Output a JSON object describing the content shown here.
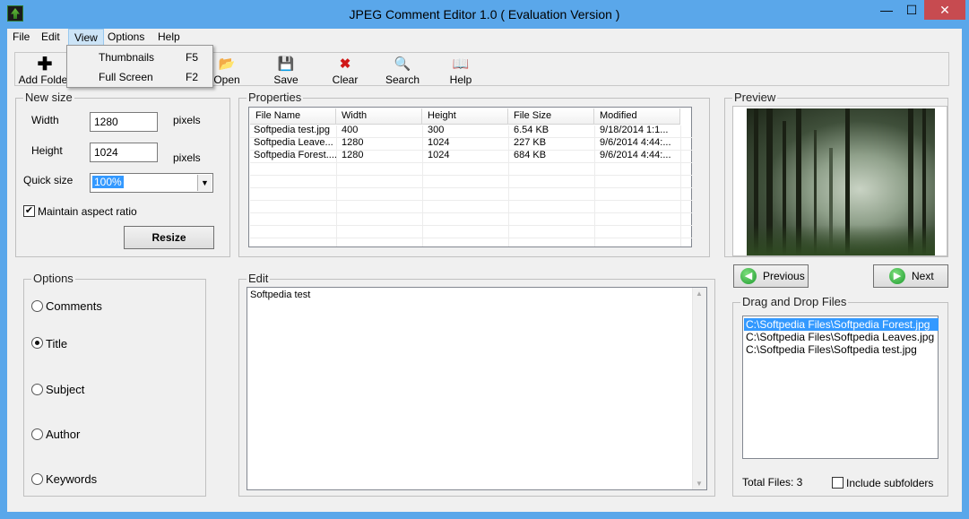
{
  "window": {
    "title": "JPEG Comment Editor 1.0 ( Evaluation Version )",
    "min_glyph": "—",
    "max_glyph": "☐",
    "close_glyph": "✕"
  },
  "menubar": {
    "file": "File",
    "edit": "Edit",
    "view": "View",
    "options": "Options",
    "help": "Help"
  },
  "view_menu": {
    "items": [
      {
        "label": "Thumbnails",
        "shortcut": "F5"
      },
      {
        "label": "Full Screen",
        "shortcut": "F2"
      }
    ]
  },
  "toolbar": {
    "add_folder": "Add Folder",
    "open": "Open",
    "save": "Save",
    "clear": "Clear",
    "search": "Search",
    "help": "Help",
    "icons": {
      "add_folder": "plus-icon",
      "open": "folder-open-icon",
      "save": "floppy-icon",
      "clear": "red-x-icon",
      "search": "search-icon",
      "help": "book-icon"
    }
  },
  "new_size": {
    "title": "New size",
    "width_label": "Width",
    "width_value": "1280",
    "width_unit": "pixels",
    "height_label": "Height",
    "height_value": "1024",
    "height_unit": "pixels",
    "quick_size_label": "Quick size",
    "quick_size_value": "100%",
    "maintain_aspect": "Maintain aspect ratio",
    "maintain_checked": true,
    "resize_button": "Resize"
  },
  "properties": {
    "title": "Properties",
    "columns": [
      "File Name",
      "Width",
      "Height",
      "File Size",
      "Modified"
    ],
    "rows": [
      [
        "Softpedia test.jpg",
        "400",
        "300",
        "6.54 KB",
        "9/18/2014 1:1..."
      ],
      [
        "Softpedia Leave...",
        "1280",
        "1024",
        "227 KB",
        "9/6/2014 4:44:..."
      ],
      [
        "Softpedia Forest....",
        "1280",
        "1024",
        "684 KB",
        "9/6/2014 4:44:..."
      ]
    ]
  },
  "preview": {
    "title": "Preview",
    "previous": "Previous",
    "next": "Next"
  },
  "options": {
    "title": "Options",
    "items": [
      "Comments",
      "Title",
      "Subject",
      "Author",
      "Keywords"
    ],
    "selected": "Title"
  },
  "edit": {
    "title": "Edit",
    "text": "Softpedia test"
  },
  "dragdrop": {
    "title": "Drag and Drop Files",
    "files": [
      "C:\\Softpedia Files\\Softpedia Forest.jpg",
      "C:\\Softpedia Files\\Softpedia Leaves.jpg",
      "C:\\Softpedia Files\\Softpedia test.jpg"
    ],
    "total_files": "Total Files: 3",
    "include_subfolders": "Include subfolders"
  },
  "colors": {
    "titlebar": "#5aa7ea",
    "selection": "#3399ff",
    "close": "#c74b50"
  }
}
